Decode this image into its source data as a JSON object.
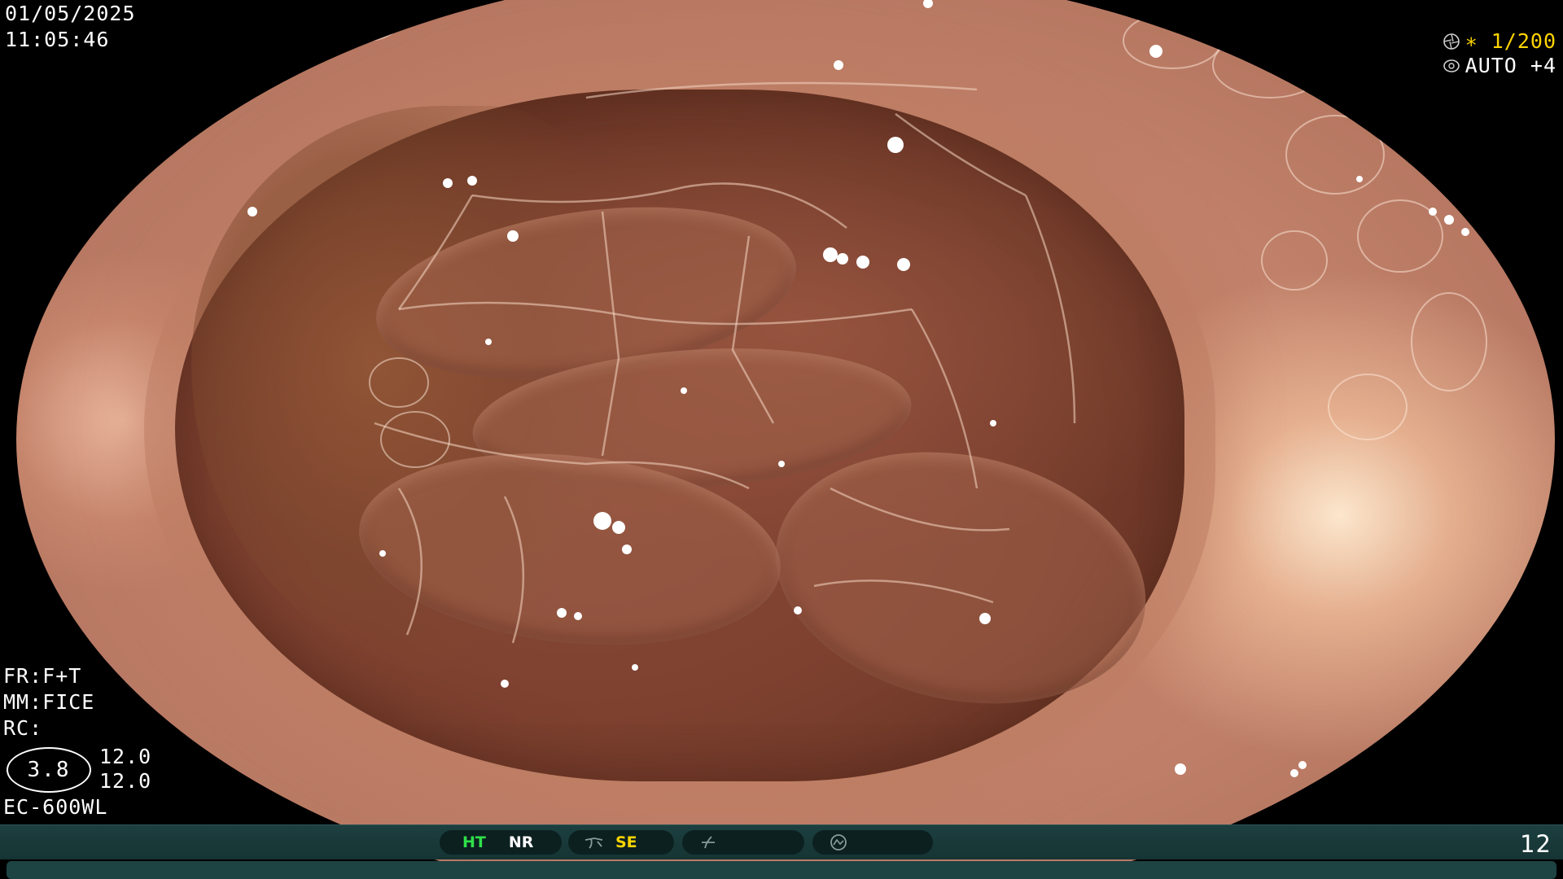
{
  "overlay": {
    "date": "01/05/2025",
    "time": "11:05:46",
    "shutter_speed": "∗ 1/200",
    "exposure": "AUTO +4",
    "shutter_icon": "aperture-icon",
    "exposure_icon": "iris-icon",
    "fr_mode": "FR:F+T",
    "mm_mode": "MM:FICE",
    "rc_mode": "RC:",
    "zoom_value": "3.8",
    "enhancement_a": "12.0",
    "enhancement_b": "12.0",
    "scope_model": "EC-600WL"
  },
  "status_bar": {
    "items": [
      {
        "label": "HT",
        "color": "#2fe04a"
      },
      {
        "label": "NR",
        "color": "#ffffff"
      },
      {
        "label": "SE",
        "color": "#ffd400"
      }
    ],
    "frame_number": "12",
    "icons": [
      "structure-enhance-icon",
      "color-mode-icon",
      "pump-icon"
    ]
  }
}
